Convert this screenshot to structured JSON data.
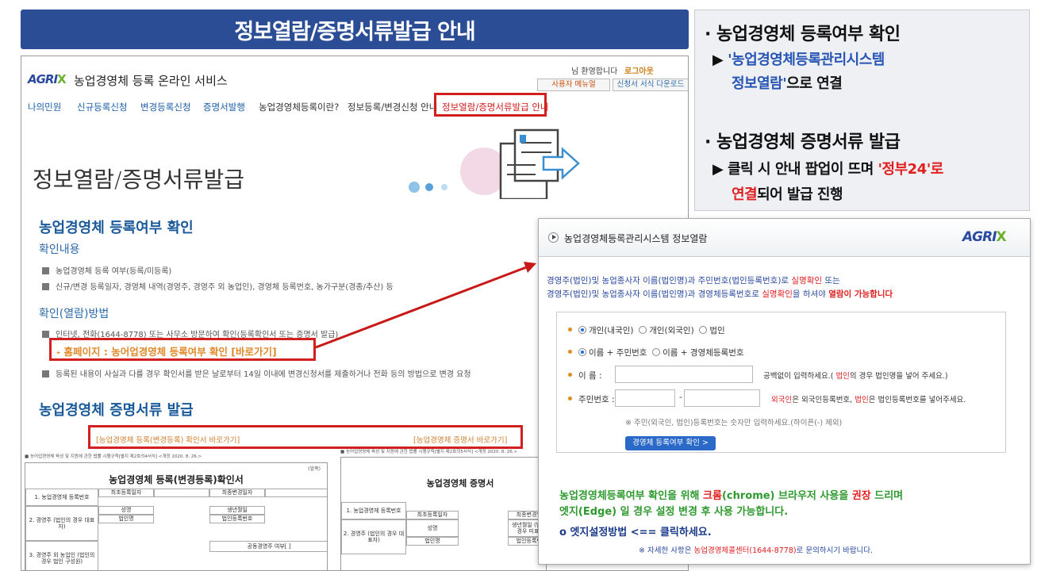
{
  "banner": {
    "title": "정보열람/증명서류발급 안내"
  },
  "info": {
    "h1": "· 농업경영체 등록여부 확인",
    "l1_prefix": "▶ ",
    "l1_blue": "'농업경영체등록관리시스템",
    "l2_blue": "정보열람'",
    "l2_rest": "으로 연결",
    "h2": "· 농업경영체 증명서류 발급",
    "l3_prefix": "▶ 클릭 시 안내 팝업이 뜨며 ",
    "l3_red": "'정부24'로",
    "l4_red": "연결",
    "l4_rest": "되어 발급 진행"
  },
  "site": {
    "logo_text": "AGRI",
    "logo_x": "X",
    "service": "농업경영체 등록 온라인 서비스",
    "welcome": "님 환영합니다",
    "logout": "로그아웃",
    "user_menu": "사용자 메뉴얼",
    "form_download": "신청서 서식 다운로드",
    "nav": [
      "나의민원",
      "신규등록신청",
      "변경등록신청",
      "증명서발행",
      "농업경영체등록이란?",
      "정보등록/변경신청 안내",
      "정보열람/증명서류발급 안내"
    ],
    "page_title": "정보열람/증명서류발급",
    "sec1": "농업경영체 등록여부 확인",
    "sub1": "확인내용",
    "b1": "농업경영체 등록 여부(등록/미등록)",
    "b2": "신규/변경 등록일자, 경영체 내역(경영주, 경영주 외 농업인), 경영체 등록번호, 농가구분(경종/추산) 등",
    "sub2": "확인(열람)방법",
    "b3": "인터넷, 전화(1644-8778) 또는 사무소 방문하여 확인(등록확인서 또는 증명서 발급)",
    "homepage_link": "- 홈페이지 : 농어업경영체 등록여부 확인 [바로가기]",
    "b4": "등록된 내용이 사실과 다를 경우 확인서를 받은 날로부터 14일 이내에 변경신청서를 제출하거나 전화 등의 방법으로 변경 요청",
    "sec2": "농업경영체 증명서류 발급",
    "link_left": "[농업경영체 등록(변경등록) 확인서 바로가기]",
    "link_right": "[농업경영체 증명서 바로가기]",
    "doc1_note": "■ 농어업경영체 육성 및 지원에 관한 법률 시행규칙[별지 제2호의4서식] <개정 2020. 8. 26.>",
    "doc1_page": "(앞쪽)",
    "doc1_title": "농업경영체 등록(변경등록)확인서",
    "doc1_rows": [
      "1. 농업경영체 등록번호",
      "최초등록일자",
      "최종변경일자",
      "2. 경영주 (법인의 경우 대표자)",
      "성명",
      "생년월일",
      "법인명",
      "법인등록번호",
      "3. 경영주 외 농업인 (법인의 경우 법인 구성원)",
      "공동경영주 여부[ ]"
    ],
    "doc2_note": "■ 농어업경영체 육성 및 지원에 관한 법률 시행규칙[별지 제2호의5서식] <개정 2020. 8. 26.>",
    "doc2_title": "농업경영체 증명서",
    "doc2_rows": [
      "1. 농업경영체 등록번호",
      "최초등록일자",
      "최종변경일자",
      "2. 경영주 (법인의 경우 대표자)",
      "성명",
      "생년월일 (법인의 경우 미표시)",
      "법인명",
      "법인등록번호"
    ]
  },
  "popup": {
    "title": "농업경영체등록관리시스템 정보열람",
    "logo_text": "AGRI",
    "logo_x": "X",
    "line1_a": "경영주(법인)및 농업종사자 이름(법인명)과 주민번호(법인등록번호)로 ",
    "line1_red": "실명확인",
    "line1_b": " 또는",
    "line2_a": "경영주(법인)및 농업종사자 이름(법인명)과 경영체등록번호로 ",
    "line2_red": "실명확인",
    "line2_b": "을 하셔야 ",
    "line2_bold": "열람이 가능합니다",
    "radio1": [
      "개인(내국인)",
      "개인(외국인)",
      "법인"
    ],
    "radio2": [
      "이름 + 주민번호",
      "이름 + 경영체등록번호"
    ],
    "name_label": "이      름 :",
    "name_hint_a": "공백없이 입력하세요.( ",
    "name_hint_red": "법인",
    "name_hint_b": "의 경우 법인명을 넣어 주세요.)",
    "id_label": "주민번호 :",
    "id_dash": "-",
    "id_hint_red1": "외국인",
    "id_hint_a": "은 외국인등록번호, ",
    "id_hint_red2": "법인",
    "id_hint_b": "은 법인등록번호를 넣어주세요.",
    "id_note": "※ 주민(외국인, 법인)등록번호는 숫자만 입력하세요.(하이픈(-) 제외)",
    "confirm_btn": "경영체 등록여부 확인 >",
    "notice1_a": "농업경영체등록여부 확인을 위해 ",
    "notice1_red": "크롬",
    "notice1_b": "(chrome) 브라우저 사용을 ",
    "notice1_red2": "권장",
    "notice1_c": " 드리며",
    "notice2": "엣지(Edge) 일 경우 설정 변경 후 사용 가능합니다.",
    "edge_link": "o 엣지설정방법 <== 클릭하세요.",
    "contact_a": "※ 자세한 사항은 ",
    "contact_red": "농업경영체콜센터(1644-8778)",
    "contact_b": "로 문의하시기 바랍니다."
  },
  "colors": {
    "banner": "#2a4d96",
    "highlight_red": "#d22020",
    "link_blue": "#2755b5",
    "notice_green": "#2e9a2e"
  }
}
